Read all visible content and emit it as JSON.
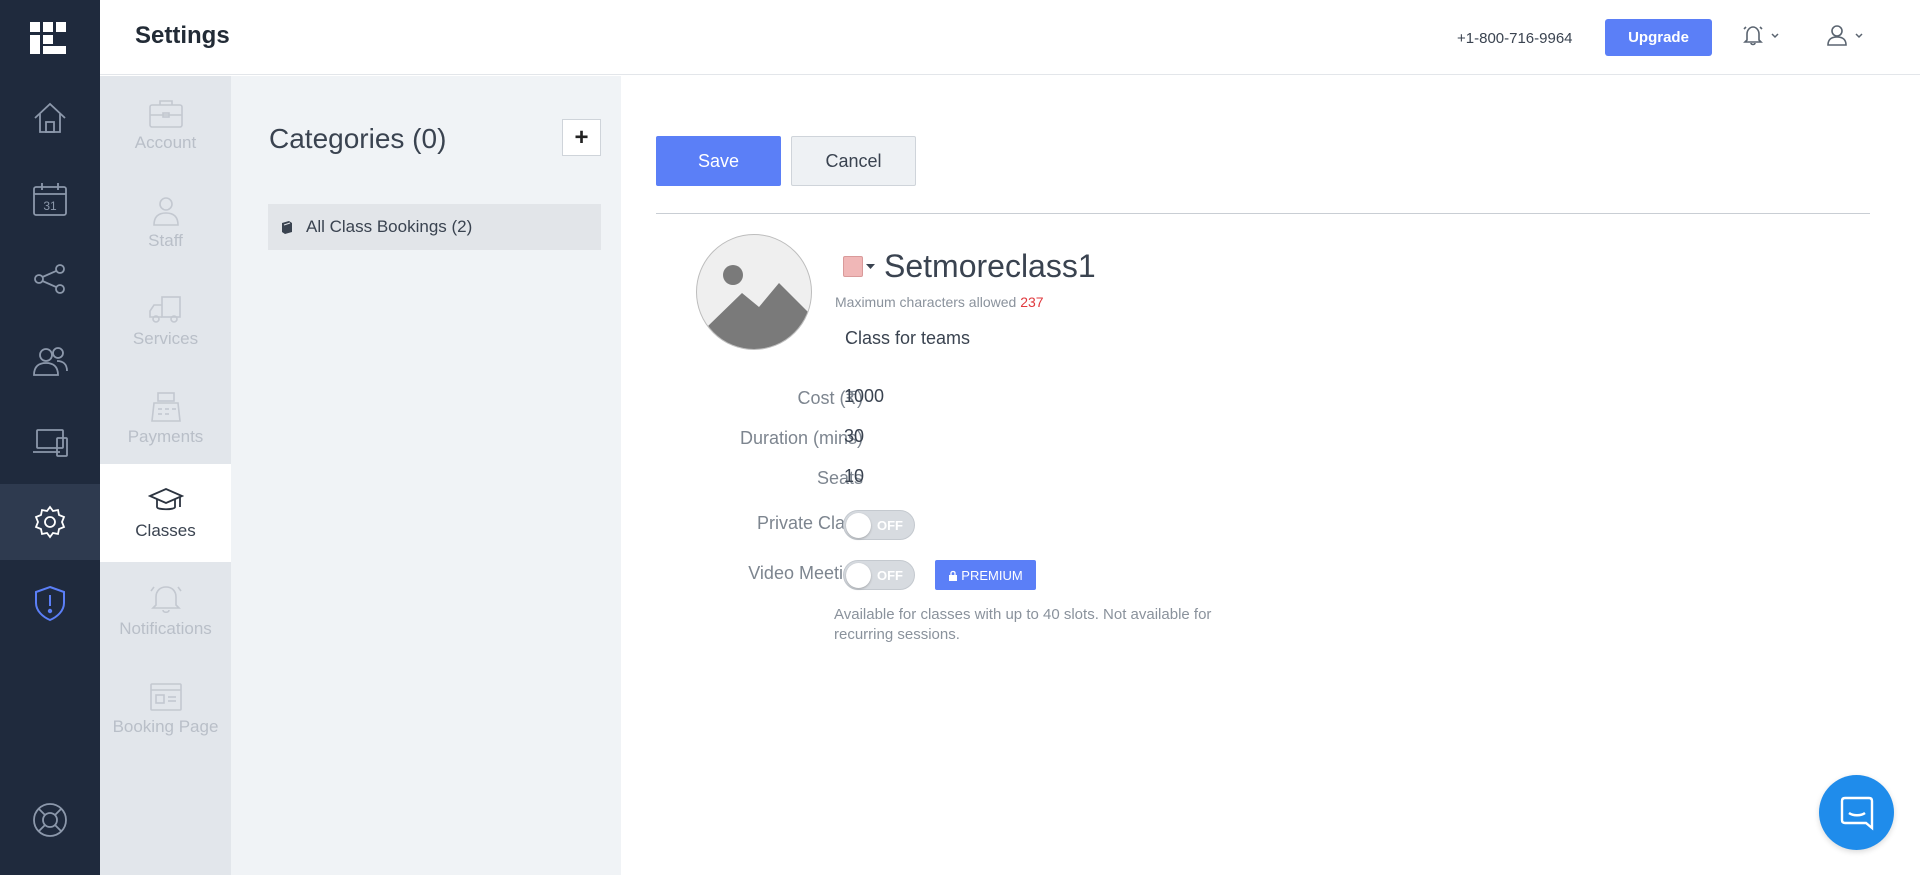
{
  "topbar": {
    "title": "Settings",
    "phone": "+1-800-716-9964",
    "upgrade_label": "Upgrade"
  },
  "rail": {
    "items": [
      "home-icon",
      "calendar-icon",
      "share-icon",
      "customers-icon",
      "devices-icon",
      "settings-icon",
      "shield-alert-icon",
      "help-lifebuoy-icon"
    ],
    "active": "settings-icon",
    "calendar_day": "31"
  },
  "subnav": {
    "items": [
      {
        "label": "Account",
        "icon": "briefcase-icon"
      },
      {
        "label": "Staff",
        "icon": "staff-icon"
      },
      {
        "label": "Services",
        "icon": "services-truck-icon"
      },
      {
        "label": "Payments",
        "icon": "register-icon"
      },
      {
        "label": "Classes",
        "icon": "graduation-cap-icon"
      },
      {
        "label": "Notifications",
        "icon": "bell-icon"
      },
      {
        "label": "Booking Page",
        "icon": "booking-page-icon"
      }
    ],
    "active": "Classes"
  },
  "categories": {
    "title": "Categories (0)",
    "add_label": "+",
    "items": [
      {
        "label": "All Class Bookings (2)"
      }
    ]
  },
  "form": {
    "save_label": "Save",
    "cancel_label": "Cancel",
    "class_name": "Setmoreclass1",
    "maxchars_label": "Maximum characters allowed",
    "maxchars_value": "237",
    "description": "Class for teams",
    "cost_label": "Cost (₹)",
    "cost_value": "1000",
    "duration_label": "Duration (mins)",
    "duration_value": "30",
    "seats_label": "Seats",
    "seats_value": "10",
    "private_label": "Private Class",
    "private_state": "OFF",
    "video_label": "Video Meeting",
    "video_state": "OFF",
    "premium_label": "PREMIUM",
    "note": "Available for classes with up to 40 slots. Not available for recurring sessions."
  },
  "colors": {
    "rail_bg": "#1f2a3d",
    "accent": "#5b7ff7",
    "class_color": "#f0b7b7",
    "warning": "#e0393e",
    "chat": "#1f8ceb"
  }
}
